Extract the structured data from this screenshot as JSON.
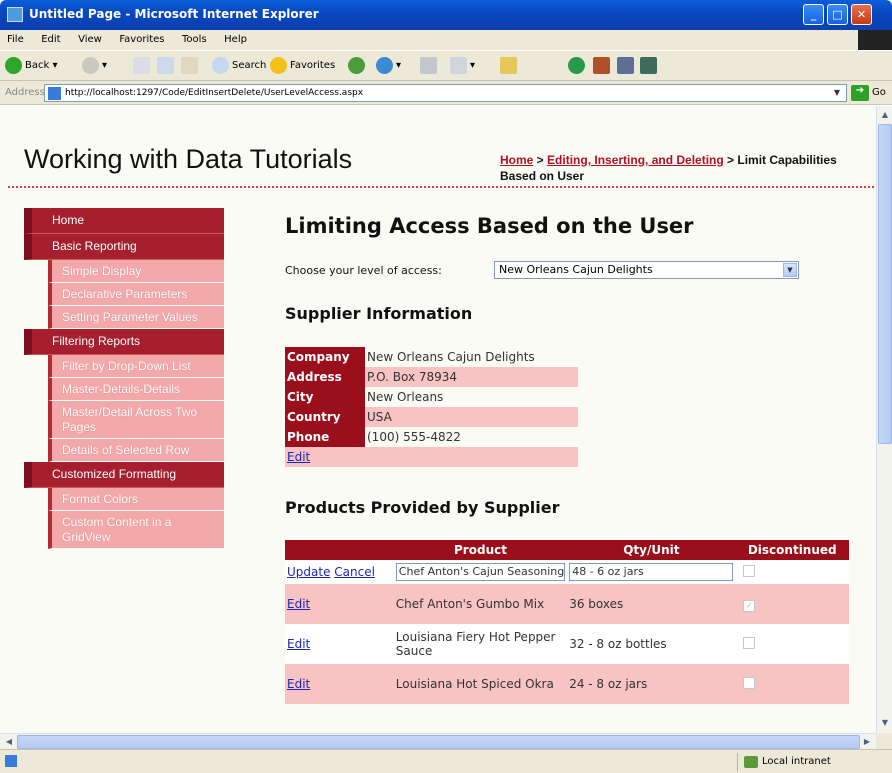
{
  "window": {
    "title": "Untitled Page - Microsoft Internet Explorer",
    "min": "_",
    "max": "□",
    "close": "✕"
  },
  "menu": [
    "File",
    "Edit",
    "View",
    "Favorites",
    "Tools",
    "Help"
  ],
  "toolbar": {
    "back": "Back",
    "search": "Search",
    "favorites": "Favorites"
  },
  "address": {
    "label": "Address",
    "url": "http://localhost:1297/Code/EditInsertDelete/UserLevelAccess.aspx",
    "go": "Go"
  },
  "status": {
    "zone": "Local intranet"
  },
  "page": {
    "site_title": "Working with Data Tutorials",
    "breadcrumb": {
      "home": "Home",
      "sep1": " > ",
      "section": "Editing, Inserting, and Deleting",
      "sep2": " > ",
      "current": "Limit Capabilities Based on User"
    },
    "nav": [
      {
        "label": "Home",
        "type": "cat"
      },
      {
        "label": "Basic Reporting",
        "type": "cat"
      },
      {
        "label": "Simple Display",
        "type": "sub"
      },
      {
        "label": "Declarative Parameters",
        "type": "sub"
      },
      {
        "label": "Setting Parameter Values",
        "type": "sub"
      },
      {
        "label": "Filtering Reports",
        "type": "cat"
      },
      {
        "label": "Filter by Drop-Down List",
        "type": "sub"
      },
      {
        "label": "Master-Details-Details",
        "type": "sub"
      },
      {
        "label": "Master/Detail Across Two Pages",
        "type": "sub"
      },
      {
        "label": "Details of Selected Row",
        "type": "sub"
      },
      {
        "label": "Customized Formatting",
        "type": "cat"
      },
      {
        "label": "Format Colors",
        "type": "sub"
      },
      {
        "label": "Custom Content in a GridView",
        "type": "sub"
      }
    ],
    "heading": "Limiting Access Based on the User",
    "access_label": "Choose your level of access:",
    "access_value": "New Orleans Cajun Delights",
    "supplier_heading": "Supplier Information",
    "supplier": [
      {
        "key": "Company",
        "value": "New Orleans Cajun Delights"
      },
      {
        "key": "Address",
        "value": "P.O. Box 78934"
      },
      {
        "key": "City",
        "value": "New Orleans"
      },
      {
        "key": "Country",
        "value": "USA"
      },
      {
        "key": "Phone",
        "value": "(100) 555-4822"
      }
    ],
    "supplier_edit": "Edit",
    "products_heading": "Products Provided by Supplier",
    "products_columns": [
      "",
      "Product",
      "Qty/Unit",
      "Discontinued"
    ],
    "products": [
      {
        "edit": "Update",
        "cancel": "Cancel",
        "product": "Chef Anton's Cajun Seasoning",
        "qty": "48 - 6 oz jars",
        "discontinued": false,
        "editing": true
      },
      {
        "edit": "Edit",
        "product": "Chef Anton's Gumbo Mix",
        "qty": "36 boxes",
        "discontinued": true,
        "editing": false
      },
      {
        "edit": "Edit",
        "product": "Louisiana Fiery Hot Pepper Sauce",
        "qty": "32 - 8 oz bottles",
        "discontinued": false,
        "editing": false
      },
      {
        "edit": "Edit",
        "product": "Louisiana Hot Spiced Okra",
        "qty": "24 - 8 oz jars",
        "discontinued": false,
        "editing": false
      }
    ]
  }
}
